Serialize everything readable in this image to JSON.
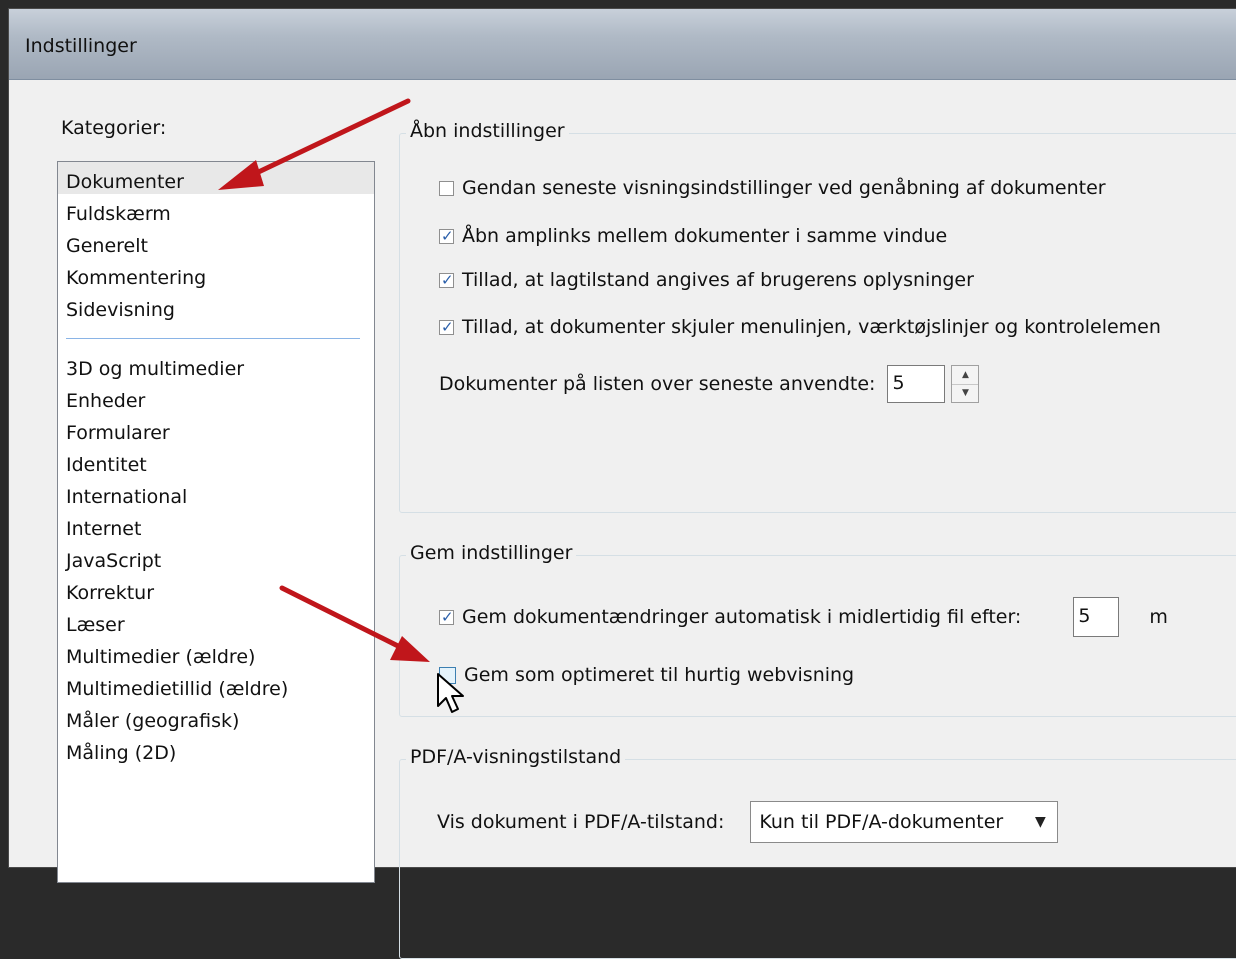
{
  "window": {
    "title": "Indstillinger"
  },
  "categories": {
    "label": "Kategorier:",
    "group1": [
      "Dokumenter",
      "Fuldskærm",
      "Generelt",
      "Kommentering",
      "Sidevisning"
    ],
    "group2": [
      "3D og multimedier",
      "Enheder",
      "Formularer",
      "Identitet",
      "International",
      "Internet",
      "JavaScript",
      "Korrektur",
      "Læser",
      "Multimedier (ældre)",
      "Multimedietillid (ældre)",
      "Måler (geografisk)",
      "Måling (2D)"
    ],
    "selected": "Dokumenter"
  },
  "open_settings": {
    "title": "Åbn indstillinger",
    "options": [
      {
        "label": "Gendan seneste visningsindstillinger ved genåbning af dokumenter",
        "checked": false
      },
      {
        "label": "Åbn amplinks mellem dokumenter i samme vindue",
        "checked": true
      },
      {
        "label": "Tillad, at lagtilstand angives af brugerens oplysninger",
        "checked": true
      },
      {
        "label": "Tillad, at dokumenter skjuler menulinjen, værktøjslinjer og kontrolelemen",
        "checked": true
      }
    ],
    "recent_label": "Dokumenter på listen over seneste anvendte:",
    "recent_value": "5"
  },
  "save_settings": {
    "title": "Gem indstillinger",
    "autosave_label": "Gem dokumentændringer automatisk i midlertidig fil efter:",
    "autosave_checked": true,
    "autosave_value": "5",
    "autosave_unit": "m",
    "optimize_label": "Gem som optimeret til hurtig webvisning",
    "optimize_checked": false
  },
  "pdfa": {
    "title": "PDF/A-visningstilstand",
    "label": "Vis dokument i PDF/A-tilstand:",
    "selected": "Kun til PDF/A-dokumenter"
  },
  "annotations": {
    "arrow_color": "#c0161b"
  }
}
